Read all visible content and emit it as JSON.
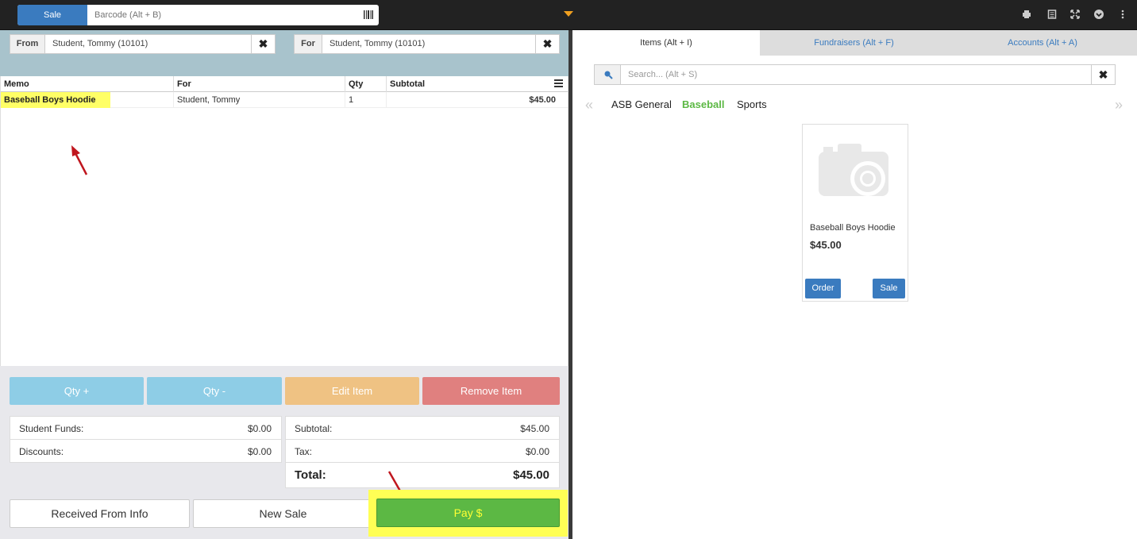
{
  "topbar": {
    "sale_label": "Sale",
    "barcode_placeholder": "Barcode (Alt + B)"
  },
  "selectors": {
    "from_label": "From",
    "from_value": "Student, Tommy (10101)",
    "for_label": "For",
    "for_value": "Student, Tommy (10101)",
    "clear_glyph": "✖"
  },
  "grid": {
    "columns": [
      "Memo",
      "For",
      "Qty",
      "Subtotal"
    ],
    "rows": [
      {
        "memo": "Baseball Boys Hoodie",
        "for": "Student, Tommy",
        "qty": "1",
        "subtotal": "$45.00"
      }
    ]
  },
  "actions": {
    "qty_plus": "Qty +",
    "qty_minus": "Qty -",
    "edit_item": "Edit Item",
    "remove_item": "Remove Item"
  },
  "summary_left": [
    {
      "label": "Student Funds:",
      "value": "$0.00"
    },
    {
      "label": "Discounts:",
      "value": "$0.00"
    }
  ],
  "summary_right": [
    {
      "label": "Subtotal:",
      "value": "$45.00"
    },
    {
      "label": "Tax:",
      "value": "$0.00"
    }
  ],
  "total": {
    "label": "Total:",
    "value": "$45.00"
  },
  "footer": {
    "received_from": "Received From Info",
    "new_sale": "New Sale",
    "pay": "Pay $"
  },
  "tabs": [
    "Items (Alt + I)",
    "Fundraisers (Alt + F)",
    "Accounts (Alt + A)"
  ],
  "search": {
    "placeholder": "Search... (Alt + S)"
  },
  "nav": {
    "prev": "«",
    "next": "»"
  },
  "categories": [
    "ASB General",
    "Baseball",
    "Sports"
  ],
  "active_category": "Baseball",
  "product": {
    "name": "Baseball Boys Hoodie",
    "price": "$45.00",
    "order_label": "Order",
    "sale_label": "Sale"
  },
  "colors": {
    "primary": "#3a7bbf",
    "success": "#5cb844",
    "highlight": "#ffff66",
    "qty_btn": "#8ecde6",
    "edit_btn": "#efc283",
    "remove_btn": "#e0807f"
  }
}
